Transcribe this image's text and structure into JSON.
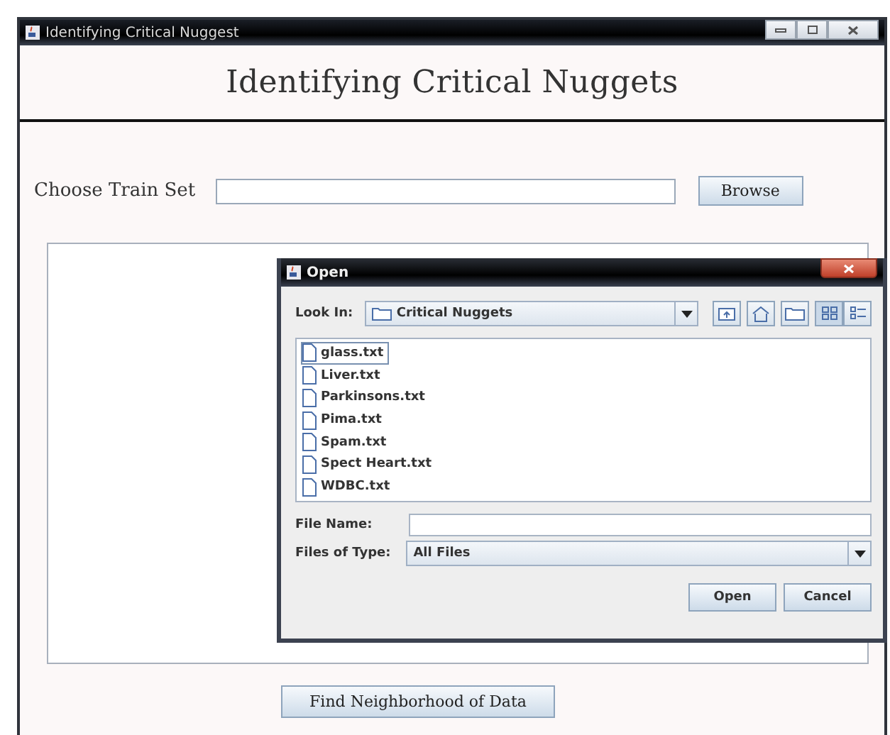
{
  "window": {
    "title": "Identifying Critical Nuggest"
  },
  "heading": "Identifying Critical Nuggets",
  "train_set": {
    "label": "Choose Train Set",
    "browse_button": "Browse"
  },
  "action_button": "Find Neighborhood of Data",
  "dialog": {
    "title": "Open",
    "look_in": {
      "label": "Look In:",
      "value": "Critical Nuggets"
    },
    "files": [
      {
        "name": "glass.txt",
        "selected": true
      },
      {
        "name": "Liver.txt",
        "selected": false
      },
      {
        "name": "Parkinsons.txt",
        "selected": false
      },
      {
        "name": "Pima.txt",
        "selected": false
      },
      {
        "name": "Spam.txt",
        "selected": false
      },
      {
        "name": "Spect Heart.txt",
        "selected": false
      },
      {
        "name": "WDBC.txt",
        "selected": false
      }
    ],
    "file_name": {
      "label": "File Name:"
    },
    "file_type": {
      "label": "Files of Type:",
      "value": "All Files"
    },
    "buttons": [
      "Open",
      "Cancel"
    ]
  }
}
